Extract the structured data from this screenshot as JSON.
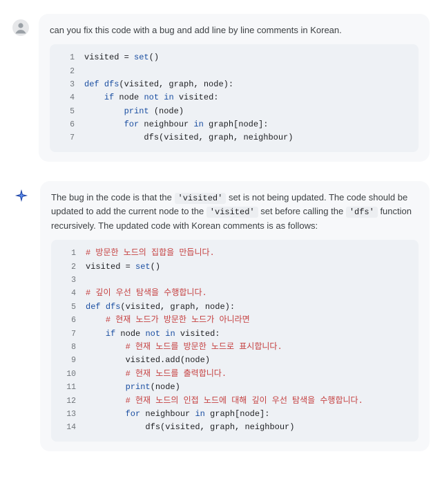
{
  "user": {
    "prompt": "can you fix this code with a bug and add line by line comments in Korean.",
    "code": [
      [
        {
          "t": "visited = ",
          "cls": ""
        },
        {
          "t": "set",
          "cls": "fn"
        },
        {
          "t": "()",
          "cls": ""
        }
      ],
      [],
      [
        {
          "t": "def ",
          "cls": "kw"
        },
        {
          "t": "dfs",
          "cls": "fn"
        },
        {
          "t": "(visited, graph, node):",
          "cls": ""
        }
      ],
      [
        {
          "t": "    ",
          "cls": ""
        },
        {
          "t": "if ",
          "cls": "kw"
        },
        {
          "t": "node ",
          "cls": ""
        },
        {
          "t": "not in ",
          "cls": "kw"
        },
        {
          "t": "visited:",
          "cls": ""
        }
      ],
      [
        {
          "t": "        ",
          "cls": ""
        },
        {
          "t": "print ",
          "cls": "fn"
        },
        {
          "t": "(node)",
          "cls": ""
        }
      ],
      [
        {
          "t": "        ",
          "cls": ""
        },
        {
          "t": "for ",
          "cls": "kw"
        },
        {
          "t": "neighbour ",
          "cls": ""
        },
        {
          "t": "in ",
          "cls": "kw"
        },
        {
          "t": "graph[node]:",
          "cls": ""
        }
      ],
      [
        {
          "t": "            dfs(visited, graph, neighbour)",
          "cls": ""
        }
      ]
    ]
  },
  "ai": {
    "text_fragments": [
      {
        "t": "The bug in the code is that the ",
        "code": false
      },
      {
        "t": "'visited'",
        "code": true
      },
      {
        "t": " set is not being updated. The code should be updated to add the current node to the ",
        "code": false
      },
      {
        "t": "'visited'",
        "code": true
      },
      {
        "t": " set before calling the ",
        "code": false
      },
      {
        "t": "'dfs'",
        "code": true
      },
      {
        "t": " function recursively. The updated code with Korean comments is as follows:",
        "code": false
      }
    ],
    "code": [
      [
        {
          "t": "# 방문한 노드의 집합을 만듭니다.",
          "cls": "c"
        }
      ],
      [
        {
          "t": "visited = ",
          "cls": ""
        },
        {
          "t": "set",
          "cls": "fn"
        },
        {
          "t": "()",
          "cls": ""
        }
      ],
      [],
      [
        {
          "t": "# 깊이 우선 탐색을 수행합니다.",
          "cls": "c"
        }
      ],
      [
        {
          "t": "def ",
          "cls": "kw"
        },
        {
          "t": "dfs",
          "cls": "fn"
        },
        {
          "t": "(visited, graph, node):",
          "cls": ""
        }
      ],
      [
        {
          "t": "    ",
          "cls": ""
        },
        {
          "t": "# 현재 노드가 방문한 노드가 아니라면",
          "cls": "c"
        }
      ],
      [
        {
          "t": "    ",
          "cls": ""
        },
        {
          "t": "if ",
          "cls": "kw"
        },
        {
          "t": "node ",
          "cls": ""
        },
        {
          "t": "not in ",
          "cls": "kw"
        },
        {
          "t": "visited:",
          "cls": ""
        }
      ],
      [
        {
          "t": "        ",
          "cls": ""
        },
        {
          "t": "# 현재 노드를 방문한 노드로 표시합니다.",
          "cls": "c"
        }
      ],
      [
        {
          "t": "        visited.add(node)",
          "cls": ""
        }
      ],
      [
        {
          "t": "        ",
          "cls": ""
        },
        {
          "t": "# 현재 노드를 출력합니다.",
          "cls": "c"
        }
      ],
      [
        {
          "t": "        ",
          "cls": ""
        },
        {
          "t": "print",
          "cls": "fn"
        },
        {
          "t": "(node)",
          "cls": ""
        }
      ],
      [
        {
          "t": "        ",
          "cls": ""
        },
        {
          "t": "# 현재 노드의 인접 노드에 대해 깊이 우선 탐색을 수행합니다.",
          "cls": "c"
        }
      ],
      [
        {
          "t": "        ",
          "cls": ""
        },
        {
          "t": "for ",
          "cls": "kw"
        },
        {
          "t": "neighbour ",
          "cls": ""
        },
        {
          "t": "in ",
          "cls": "kw"
        },
        {
          "t": "graph[node]:",
          "cls": ""
        }
      ],
      [
        {
          "t": "            dfs(visited, graph, neighbour)",
          "cls": ""
        }
      ]
    ]
  }
}
